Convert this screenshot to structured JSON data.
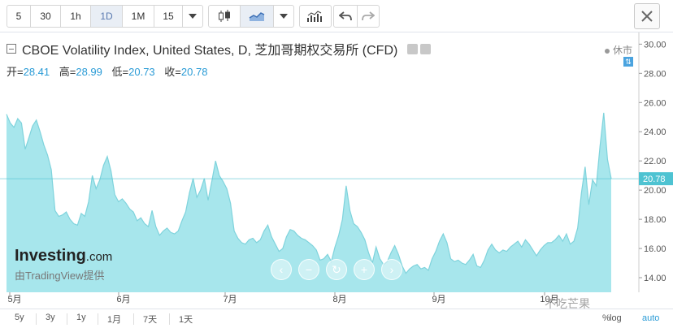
{
  "toolbar": {
    "intervals": [
      "5",
      "30",
      "1h",
      "1D",
      "1M",
      "15"
    ],
    "active_interval": "1D"
  },
  "legend": {
    "title": "CBOE Volatility Index, United States, D, 芝加哥期权交易所 (CFD)",
    "open_label": "开=",
    "open_value": "28.41",
    "high_label": "高=",
    "high_value": "28.99",
    "low_label": "低=",
    "low_value": "20.73",
    "close_label": "收=",
    "close_value": "20.78",
    "market_status": "休市"
  },
  "watermark": {
    "brand": "Investing",
    "brand_suffix": ".com",
    "powered_by": "由TradingView提供"
  },
  "bottom": {
    "ranges": [
      "5y",
      "3y",
      "1y",
      "1月",
      "7天",
      "1天"
    ],
    "percent": "%",
    "log": "log",
    "auto": "auto"
  },
  "corner_watermark": "不吃芒果",
  "colors": {
    "area_fill": "#a7e6ec",
    "area_line": "#7fd3dc",
    "last_price": "#4ec3d2",
    "value_text": "#2a9bd6"
  },
  "chart_data": {
    "type": "area",
    "x_month_labels": [
      "5月",
      "6月",
      "7月",
      "8月",
      "9月",
      "10月"
    ],
    "y_ticks": [
      14.0,
      16.0,
      18.0,
      20.0,
      22.0,
      24.0,
      26.0,
      28.0,
      30.0
    ],
    "ylim": [
      13.0,
      30.8
    ],
    "last_price": 20.78,
    "last_price_label": "20.78",
    "series": [
      {
        "values": [
          25.2,
          24.6,
          24.3,
          24.9,
          24.6,
          22.8,
          23.6,
          24.4,
          24.8,
          24.0,
          23.1,
          22.4,
          21.4,
          18.6,
          18.2,
          18.3,
          18.5,
          18.0,
          17.7,
          17.6,
          18.4,
          18.2,
          19.2,
          21.0,
          20.1,
          20.7,
          21.7,
          22.3,
          21.3,
          19.7,
          19.2,
          19.4,
          19.1,
          18.7,
          18.5,
          17.9,
          18.1,
          17.7,
          17.5,
          18.6,
          17.5,
          16.9,
          17.2,
          17.4,
          17.1,
          17.0,
          17.2,
          17.9,
          18.5,
          19.8,
          20.8,
          19.5,
          20.0,
          20.8,
          19.3,
          20.6,
          22.0,
          21.0,
          20.6,
          20.1,
          19.1,
          17.2,
          16.7,
          16.4,
          16.3,
          16.6,
          16.7,
          16.4,
          16.6,
          17.2,
          17.6,
          16.8,
          16.3,
          15.8,
          16.0,
          16.8,
          17.3,
          17.2,
          16.9,
          16.7,
          16.6,
          16.4,
          16.2,
          15.9,
          15.2,
          15.3,
          15.6,
          15.1,
          16.1,
          16.9,
          18.0,
          20.3,
          18.6,
          17.7,
          17.5,
          17.1,
          16.6,
          15.7,
          15.0,
          16.1,
          15.3,
          14.9,
          15.1,
          15.7,
          16.2,
          15.6,
          14.8,
          14.3,
          14.6,
          14.8,
          14.9,
          14.6,
          14.7,
          14.5,
          15.3,
          15.8,
          16.5,
          17.0,
          16.4,
          15.3,
          15.1,
          15.2,
          15.0,
          14.9,
          15.2,
          15.6,
          14.8,
          14.7,
          15.2,
          15.9,
          16.3,
          15.9,
          15.7,
          15.9,
          15.8,
          16.1,
          16.3,
          16.5,
          16.1,
          16.6,
          16.3,
          15.9,
          15.5,
          15.9,
          16.2,
          16.4,
          16.4,
          16.6,
          16.9,
          16.5,
          17.0,
          16.3,
          16.5,
          17.4,
          19.8,
          21.6,
          19.0,
          20.7,
          20.3,
          23.0,
          25.3,
          22.1,
          20.78
        ]
      }
    ]
  }
}
